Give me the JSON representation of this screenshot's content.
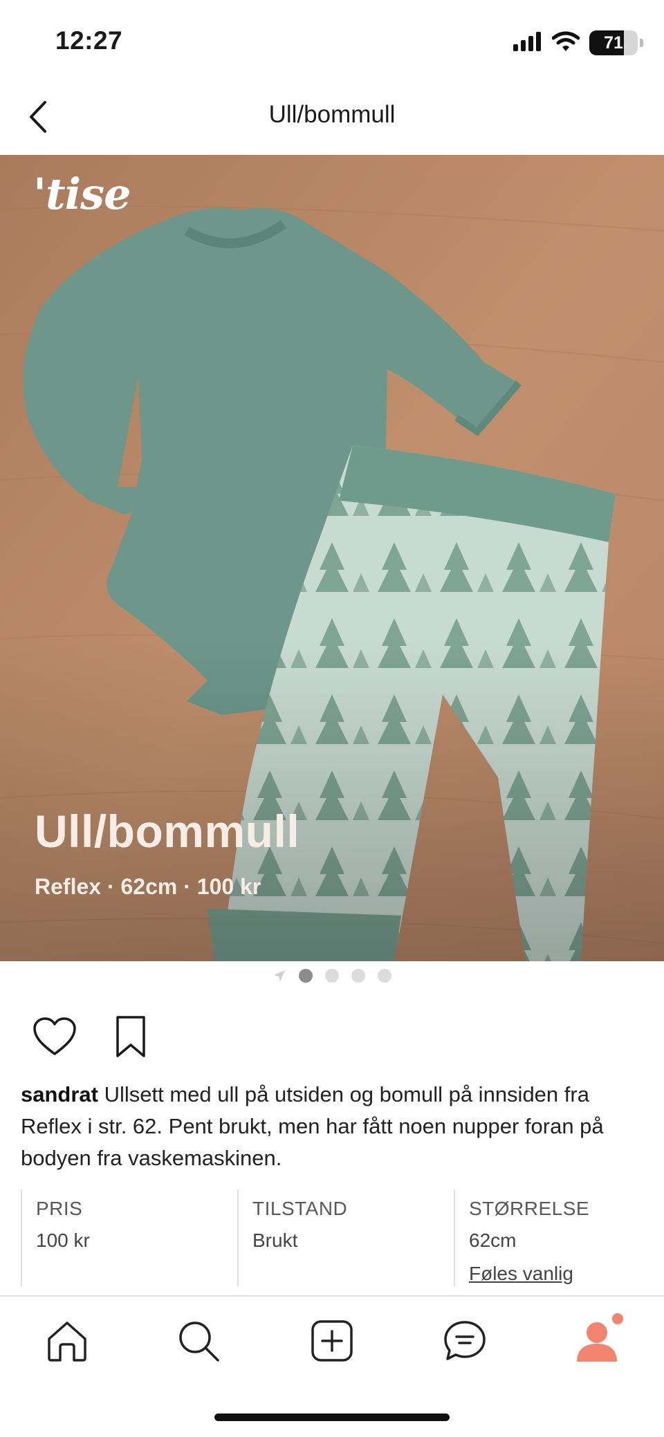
{
  "status_bar": {
    "time": "12:27",
    "battery_percent": "71",
    "battery_level": 0.71,
    "icons": [
      "cellular-signal-icon",
      "wifi-icon",
      "battery-icon"
    ]
  },
  "header": {
    "title": "Ull/bommull",
    "back_icon": "chevron-left-icon"
  },
  "hero": {
    "brand_mark": "'tise",
    "title": "Ull/bommull",
    "subtitle": "Reflex · 62cm · 100 kr",
    "pager": {
      "count": 4,
      "active_index": 0,
      "leading_icon": "navigation-arrow-icon"
    }
  },
  "actions": [
    "heart-icon",
    "bookmark-icon"
  ],
  "description": {
    "username": "sandrat",
    "text": "Ullsett med ull på utsiden og bomull på innsiden fra Reflex i str. 62. Pent brukt, men har fått noen nupper foran på bodyen fra vaskemaskinen."
  },
  "details": {
    "price": {
      "label": "PRIS",
      "value": "100 kr"
    },
    "condition": {
      "label": "TILSTAND",
      "value": "Brukt"
    },
    "size": {
      "label": "STØRRELSE",
      "value": "62cm",
      "fit_link": "Føles vanlig"
    }
  },
  "tab_bar": {
    "items": [
      "home-icon",
      "search-icon",
      "add-icon",
      "messages-icon",
      "profile-icon"
    ],
    "profile_color": "#f2836d",
    "has_notification": true
  },
  "colors": {
    "accent": "#f2836d",
    "wood": "#b98a69",
    "garment_green": "#6f9b8c",
    "leggings_light": "#c9dcd4"
  }
}
